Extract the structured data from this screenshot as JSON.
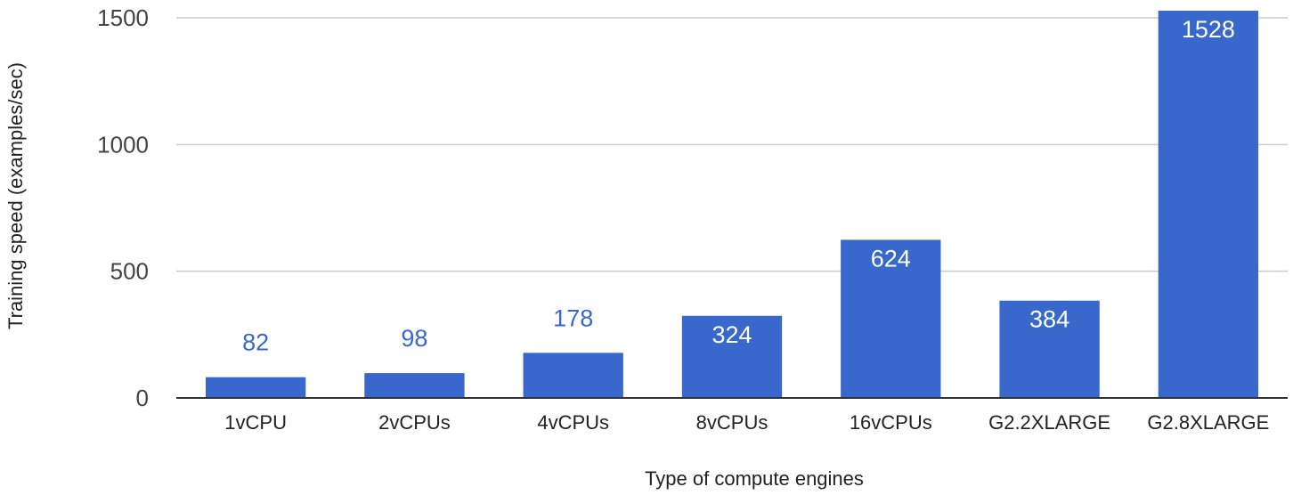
{
  "chart_data": {
    "type": "bar",
    "categories": [
      "1vCPU",
      "2vCPUs",
      "4vCPUs",
      "8vCPUs",
      "16vCPUs",
      "G2.2XLARGE",
      "G2.8XLARGE"
    ],
    "values": [
      82,
      98,
      178,
      324,
      624,
      384,
      1528
    ],
    "data_labels": [
      "82",
      "98",
      "178",
      "324",
      "624",
      "384",
      "1528"
    ],
    "title": "",
    "xlabel": "Type of compute engines",
    "ylabel": "Training speed (examples/sec)",
    "ylim": [
      0,
      1500
    ],
    "yticks": [
      0,
      500,
      1000,
      1500
    ],
    "ytick_labels": [
      "0",
      "500",
      "1000",
      "1500"
    ],
    "grid": true,
    "legend": "none",
    "colors": {
      "bar": "#3868cc",
      "label_inside": "#ffffff",
      "label_outside": "#3868cc",
      "grid": "#cccccc",
      "baseline": "#333333"
    }
  }
}
